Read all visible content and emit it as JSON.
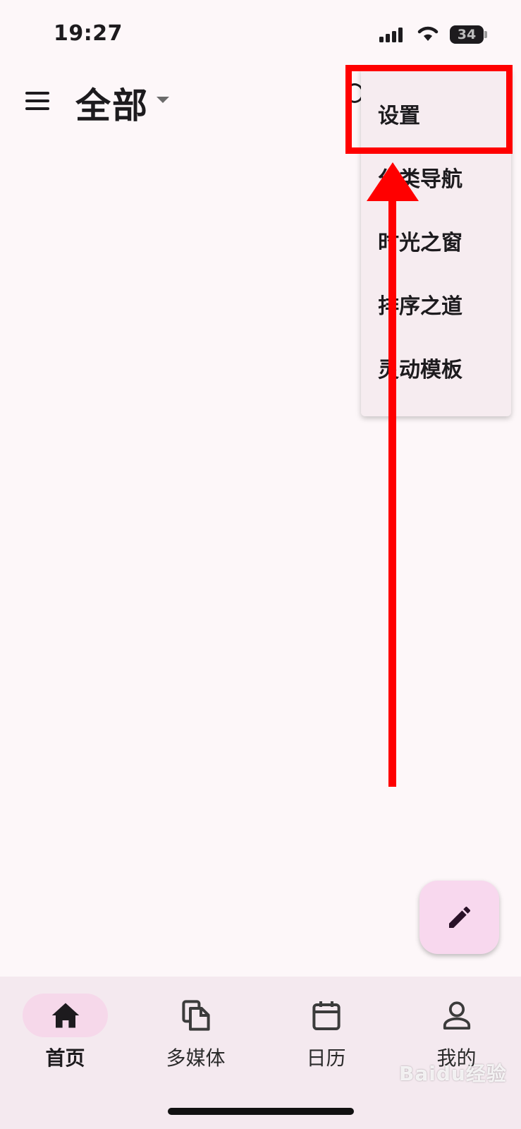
{
  "status_bar": {
    "time": "19:27",
    "battery": "34"
  },
  "header": {
    "title": "全部"
  },
  "overflow_menu": {
    "items": [
      {
        "label": "设置"
      },
      {
        "label": "分类导航"
      },
      {
        "label": "时光之窗"
      },
      {
        "label": "排序之道"
      },
      {
        "label": "灵动模板"
      }
    ]
  },
  "annotation": {
    "color": "#ff0000"
  },
  "bottom_nav": {
    "items": [
      {
        "label": "首页",
        "icon": "home-icon",
        "active": true
      },
      {
        "label": "多媒体",
        "icon": "files-icon",
        "active": false
      },
      {
        "label": "日历",
        "icon": "calendar-icon",
        "active": false
      },
      {
        "label": "我的",
        "icon": "person-icon",
        "active": false
      }
    ]
  },
  "watermark": "Baidu经验",
  "colors": {
    "background": "#fdf7f9",
    "accent": "#f6d8ea",
    "fab": "#f8d8ee",
    "menu": "#f6ecf0"
  }
}
